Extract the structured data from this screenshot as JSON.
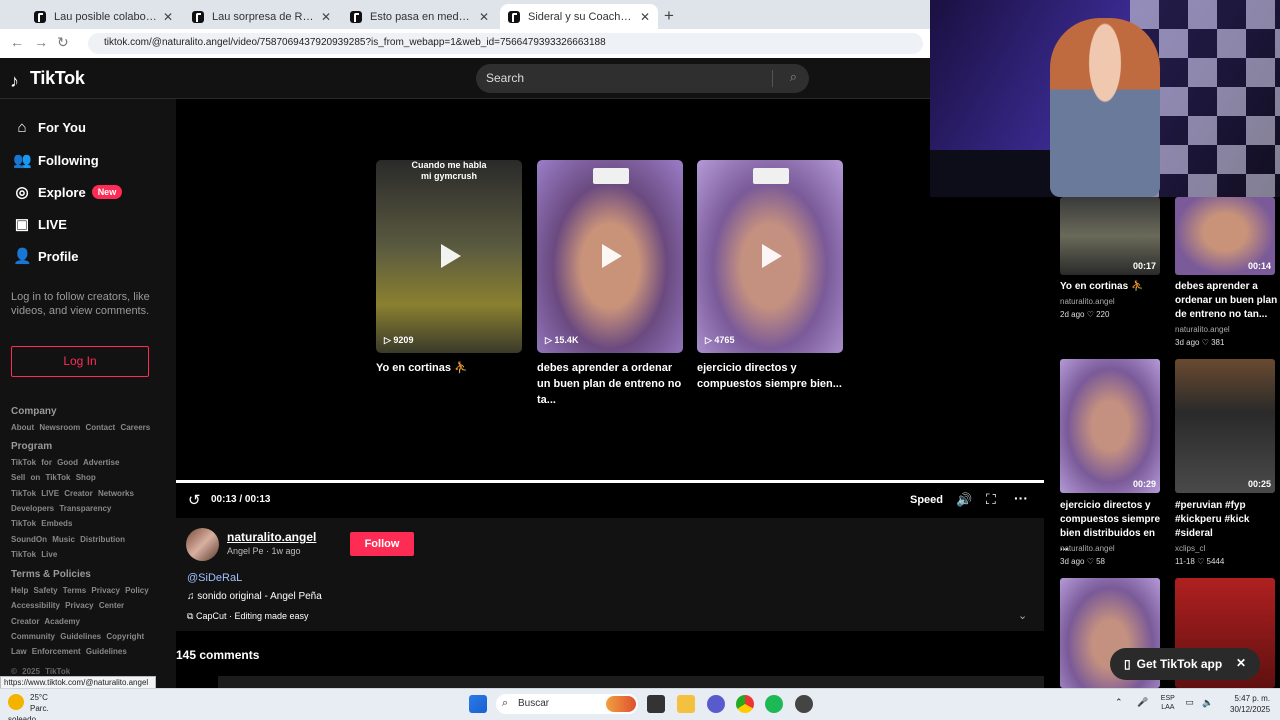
{
  "browser": {
    "tabs": [
      {
        "title": "Lau posible colaboración con S",
        "active": false
      },
      {
        "title": "Lau sorpresa de Radha #kickclip",
        "active": false
      },
      {
        "title": "Esto pasa en medalla guardián",
        "active": false
      },
      {
        "title": "Sideral y su Coach: Ejercicios N",
        "active": true
      }
    ],
    "url": "tiktok.com/@naturalito.angel/video/7587069437920939285?is_from_webapp=1&web_id=7566479393326663188",
    "link_preview": "https://www.tiktok.com/@naturalito.angel"
  },
  "tiktok": {
    "logo": "TikTok",
    "search_placeholder": "Search",
    "nav": [
      {
        "label": "For You",
        "icon": "home-icon"
      },
      {
        "label": "Following",
        "icon": "users-icon"
      },
      {
        "label": "Explore",
        "icon": "compass-icon",
        "badge": "New"
      },
      {
        "label": "LIVE",
        "icon": "live-icon"
      },
      {
        "label": "Profile",
        "icon": "person-icon"
      }
    ],
    "login_text": "Log in to follow creators, like videos, and view comments.",
    "login_button": "Log In",
    "footer": {
      "company_heading": "Company",
      "company_links": "About Newsroom Contact Careers",
      "program_heading": "Program",
      "program_lines": [
        "TikTok for Good Advertise",
        "Sell on TikTok Shop",
        "TikTok LIVE Creator Networks",
        "Developers Transparency",
        "TikTok Embeds",
        "SoundOn Music Distribution",
        "TikTok Live"
      ],
      "terms_heading": "Terms & Policies",
      "terms_lines": [
        "Help Safety Terms Privacy Policy",
        "Accessibility Privacy Center",
        "Creator Academy",
        "Community Guidelines Copyright",
        "Law Enforcement Guidelines"
      ],
      "copyright": "© 2025 TikTok"
    },
    "player": {
      "suggested": [
        {
          "views": "9209",
          "caption": "Yo en cortinas ⛹",
          "overlay": "Cuando me habla mi gymcrush"
        },
        {
          "views": "15.4K",
          "caption": "debes aprender a ordenar un buen plan de entreno no ta..."
        },
        {
          "views": "4765",
          "caption": "ejercicio directos y compuestos siempre bien..."
        }
      ],
      "time": "00:13 / 00:13",
      "progress": 1.0,
      "speed_label": "Speed"
    },
    "video_info": {
      "username": "naturalito.angel",
      "display_name": "Angel Pe",
      "posted": "· 1w ago",
      "follow_label": "Follow",
      "mention": "@SiDeRaL",
      "sound": "♫ sonido original - Angel Peña",
      "capcut": "CapCut · Editing made easy"
    },
    "comments_count": "145 comments",
    "related": [
      {
        "duration": "00:17",
        "title": "Yo en cortinas ⛹",
        "author": "naturalito.angel",
        "age": "2d ago",
        "likes": "220"
      },
      {
        "duration": "00:14",
        "title": "debes aprender a ordenar un buen plan de entreno no tan...",
        "author": "naturalito.angel",
        "age": "3d ago",
        "likes": "381"
      },
      {
        "duration": "00:29",
        "title": "ejercicio directos y compuestos siempre bien distribuidos en ...",
        "author": "naturalito.angel",
        "age": "3d ago",
        "likes": "58"
      },
      {
        "duration": "00:25",
        "title": "#peruvian #fyp #kickperu #kick #sideral",
        "author": "xclips_cl",
        "age": "11-18",
        "likes": "5444"
      }
    ],
    "get_app": "Get TikTok app"
  },
  "taskbar": {
    "weather_temp": "25°C",
    "weather_desc": "Parc. soleado",
    "search_label": "Buscar",
    "lang_line1": "ESP",
    "lang_line2": "LAA",
    "time": "5:47 p. m.",
    "date": "30/12/2025"
  }
}
